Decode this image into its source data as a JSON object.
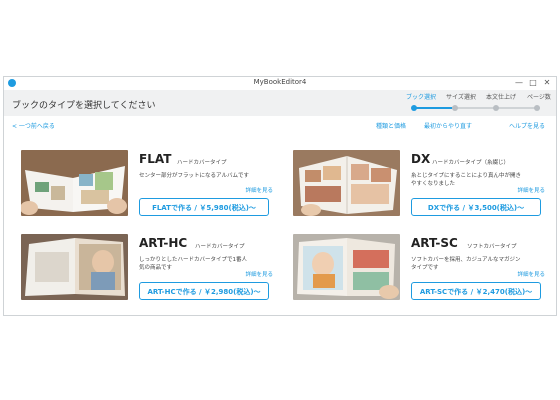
{
  "window": {
    "title": "MyBookEditor4",
    "minimize_glyph": "—",
    "maximize_glyph": "□",
    "close_glyph": "✕"
  },
  "header": {
    "title": "ブックのタイプを選択してください",
    "steps": [
      {
        "label": "ブック選択",
        "active": true
      },
      {
        "label": "サイズ選択",
        "active": false
      },
      {
        "label": "本文仕上げ",
        "active": false
      },
      {
        "label": "ページ数",
        "active": false
      }
    ]
  },
  "nav": {
    "back": "< 一つ前へ戻る",
    "types_prices": "種類と価格",
    "restart": "最初からやり直す",
    "help": "ヘルプを見る"
  },
  "products": [
    {
      "name": "FLAT",
      "subtitle": "ハードカバータイプ",
      "desc": "センター部分がフラットになるアルバムです",
      "detail": "詳細を見る",
      "button": "FLATで作る / ￥5,980(税込)〜"
    },
    {
      "name": "DX",
      "subtitle": "ハードカバータイプ（糸綴じ）",
      "desc": "糸とじタイプにすることにより真ん中が開きやすくなりました",
      "detail": "詳細を見る",
      "button": "DXで作る / ￥3,500(税込)〜"
    },
    {
      "name": "ART-HC",
      "subtitle": "ハードカバータイプ",
      "desc": "しっかりとしたハードカバータイプで1番人気の商品です",
      "detail": "詳細を見る",
      "button": "ART-HCで作る / ￥2,980(税込)〜"
    },
    {
      "name": "ART-SC",
      "subtitle": "ソフトカバータイプ",
      "desc": "ソフトカバーを採用、カジュアルなマガジンタイプです",
      "detail": "詳細を見る",
      "button": "ART-SCで作る / ￥2,470(税込)〜"
    }
  ],
  "colors": {
    "accent": "#1e9be0",
    "header_bg": "#f0f1f2"
  }
}
